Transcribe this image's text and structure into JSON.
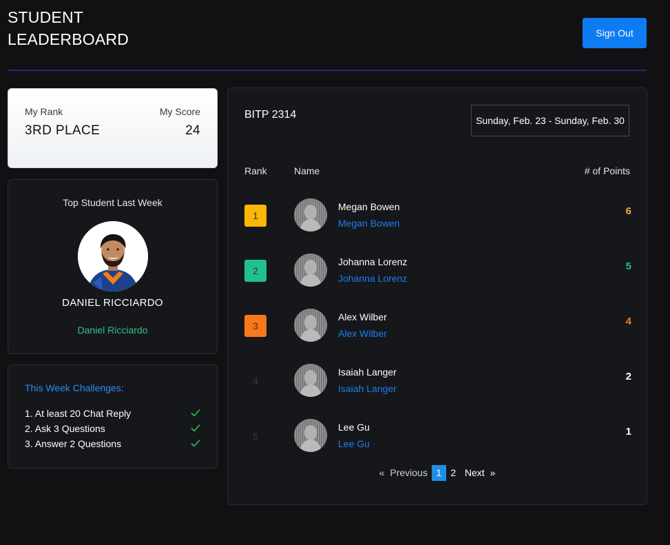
{
  "header": {
    "title": "STUDENT LEADERBOARD",
    "sign_out_label": "Sign Out"
  },
  "my_stats": {
    "rank_label": "My Rank",
    "rank_value": "3RD PLACE",
    "score_label": "My Score",
    "score_value": "24"
  },
  "top_student": {
    "heading": "Top Student Last Week",
    "name": "DANIEL RICCIARDO",
    "subtitle": "Daniel Ricciardo"
  },
  "challenges": {
    "heading": "This Week Challenges:",
    "items": [
      {
        "text": "1. At least 20 Chat Reply",
        "done": true
      },
      {
        "text": "2. Ask 3 Questions",
        "done": true
      },
      {
        "text": "3. Answer 2 Questions",
        "done": true
      }
    ]
  },
  "board": {
    "course": "BITP 2314",
    "date_range": "Sunday, Feb. 23 - Sunday, Feb. 30",
    "columns": {
      "rank": "Rank",
      "name": "Name",
      "points": "# of Points"
    },
    "rows": [
      {
        "rank": "1",
        "name": "Megan Bowen",
        "link": "Megan Bowen",
        "points": "6",
        "badge_color": "#f9b707",
        "points_color": "#f3a93a"
      },
      {
        "rank": "2",
        "name": "Johanna Lorenz",
        "link": "Johanna Lorenz",
        "points": "5",
        "badge_color": "#22c08e",
        "points_color": "#22c08e"
      },
      {
        "rank": "3",
        "name": "Alex Wilber",
        "link": "Alex Wilber",
        "points": "4",
        "badge_color": "#f8791a",
        "points_color": "#f8791a"
      },
      {
        "rank": "4",
        "name": "Isaiah Langer",
        "link": "Isaiah Langer",
        "points": "2",
        "badge_color": "",
        "points_color": "#ffffff"
      },
      {
        "rank": "5",
        "name": "Lee Gu",
        "link": "Lee Gu",
        "points": "1",
        "badge_color": "",
        "points_color": "#ffffff"
      }
    ],
    "pagination": {
      "prev_arrow": "«",
      "prev_label": "Previous",
      "pages": [
        "1",
        "2"
      ],
      "current_page": "1",
      "next_label": "Next",
      "next_arrow": "»"
    }
  },
  "colors": {
    "accent": "#0d7cf2",
    "divider": "#3a1f73",
    "success": "#2fc38a"
  }
}
